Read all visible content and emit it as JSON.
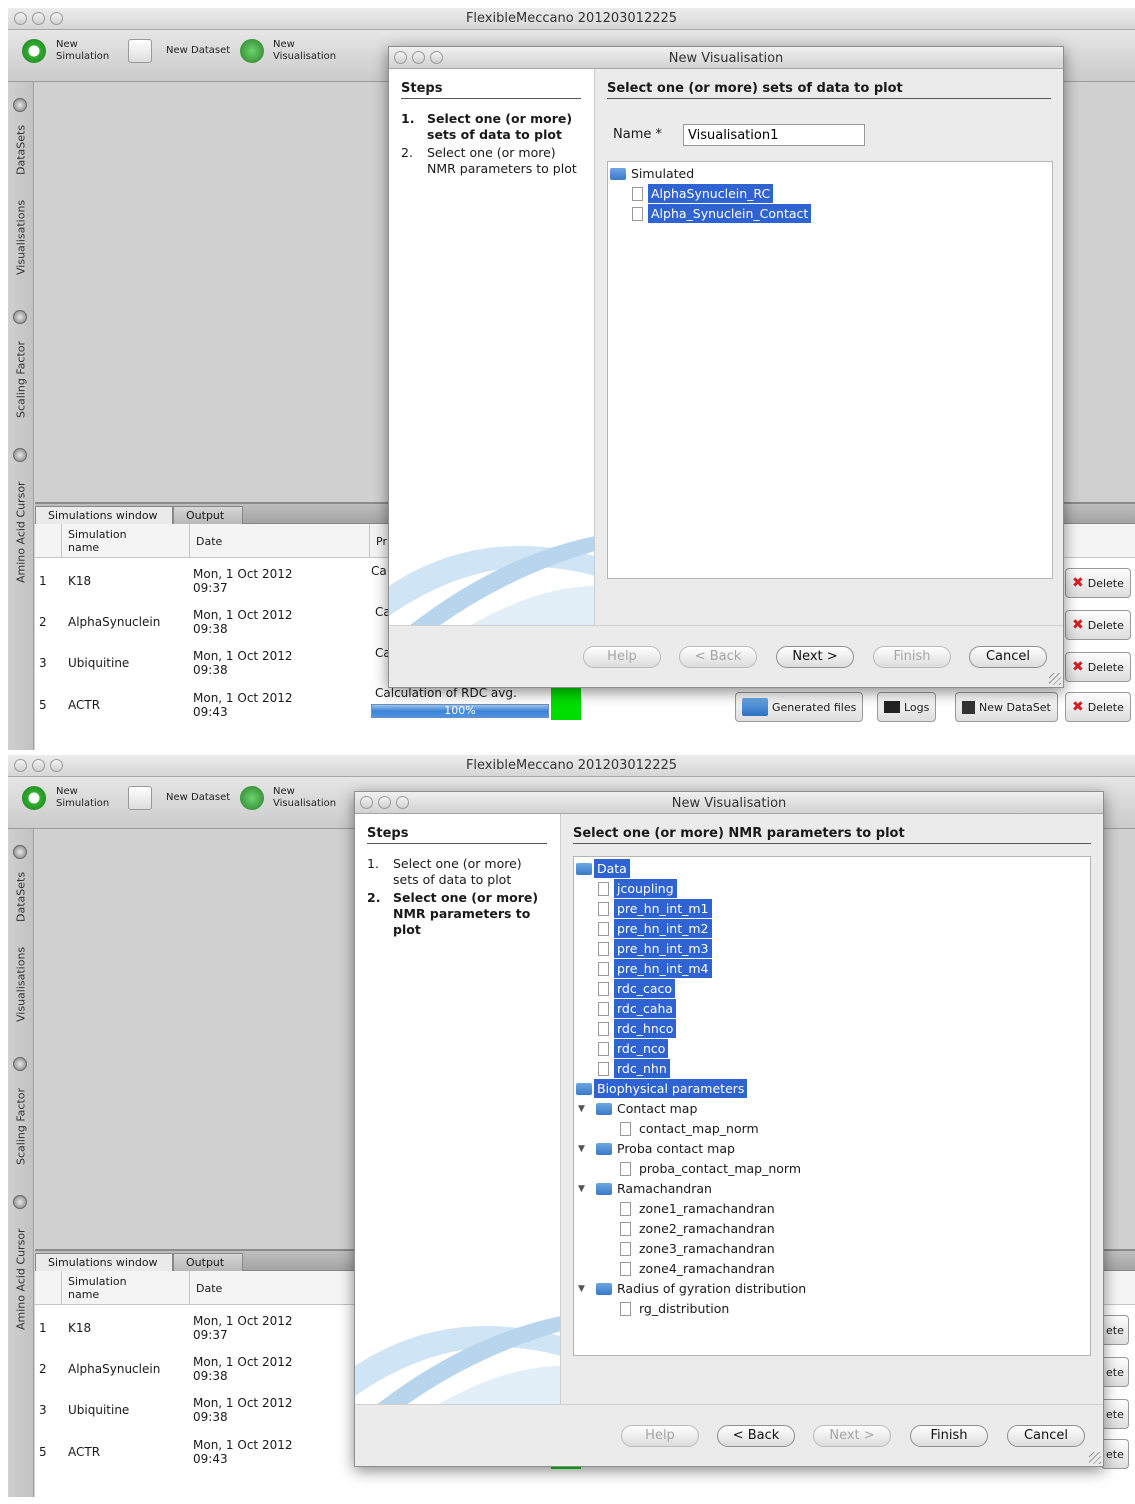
{
  "app": {
    "title": "FlexibleMeccano 201203012225",
    "toolbar": {
      "new_simulation": "New\nSimulation",
      "new_dataset": "New Dataset",
      "new_visualisation": "New\nVisualisation"
    },
    "sidebar_tabs": [
      "DataSets",
      "Visualisations",
      "Scaling Factor",
      "Amino Acid Cursor"
    ]
  },
  "bottom_panel": {
    "tabs": [
      "Simulations window",
      "Output"
    ],
    "headers": {
      "simulation_name": "Simulation\nname",
      "date": "Date",
      "progress_partial": "Pr"
    },
    "rows": [
      {
        "num": "1",
        "name": "K18",
        "date": "Mon, 1 Oct 2012\n09:37",
        "progress_label_partial": "Ca"
      },
      {
        "num": "2",
        "name": "AlphaSynuclein",
        "date": "Mon, 1 Oct 2012\n09:38",
        "progress_label_partial": "Ca"
      },
      {
        "num": "3",
        "name": "Ubiquitine",
        "date": "Mon, 1 Oct 2012\n09:38",
        "progress_label_partial": "Ca"
      },
      {
        "num": "5",
        "name": "ACTR",
        "date": "Mon, 1 Oct 2012\n09:43",
        "progress_label": "Calculation of RDC avg.",
        "progress_value": "100%"
      }
    ],
    "actions": {
      "generated_files": "Generated files",
      "logs": "Logs",
      "new_dataset": "New DataSet",
      "delete": "Delete",
      "delete_partial": "ete"
    }
  },
  "dialog": {
    "title": "New Visualisation",
    "steps_header": "Steps",
    "steps": [
      {
        "num": "1.",
        "text": "Select one (or more) sets of data to plot"
      },
      {
        "num": "2.",
        "text": "Select one (or more) NMR parameters to plot"
      }
    ],
    "buttons": {
      "help": "Help",
      "back": "< Back",
      "next": "Next >",
      "finish": "Finish",
      "cancel": "Cancel"
    }
  },
  "step1": {
    "header": "Select one (or more) sets of data to plot",
    "name_label": "Name *",
    "name_value": "Visualisation1",
    "tree": {
      "folder": "Simulated",
      "items": [
        "AlphaSynuclein_RC",
        "Alpha_Synuclein_Contact"
      ]
    }
  },
  "step2": {
    "header": "Select one (or more) NMR parameters to plot",
    "tree": {
      "data_folder": "Data",
      "data_items": [
        "jcoupling",
        "pre_hn_int_m1",
        "pre_hn_int_m2",
        "pre_hn_int_m3",
        "pre_hn_int_m4",
        "rdc_caco",
        "rdc_caha",
        "rdc_hnco",
        "rdc_nco",
        "rdc_nhn"
      ],
      "bio_folder": "Biophysical parameters",
      "groups": [
        {
          "name": "Contact map",
          "items": [
            "contact_map_norm"
          ]
        },
        {
          "name": "Proba contact map",
          "items": [
            "proba_contact_map_norm"
          ]
        },
        {
          "name": "Ramachandran",
          "items": [
            "zone1_ramachandran",
            "zone2_ramachandran",
            "zone3_ramachandran",
            "zone4_ramachandran"
          ]
        },
        {
          "name": "Radius of gyration distribution",
          "items": [
            "rg_distribution"
          ]
        }
      ]
    }
  }
}
